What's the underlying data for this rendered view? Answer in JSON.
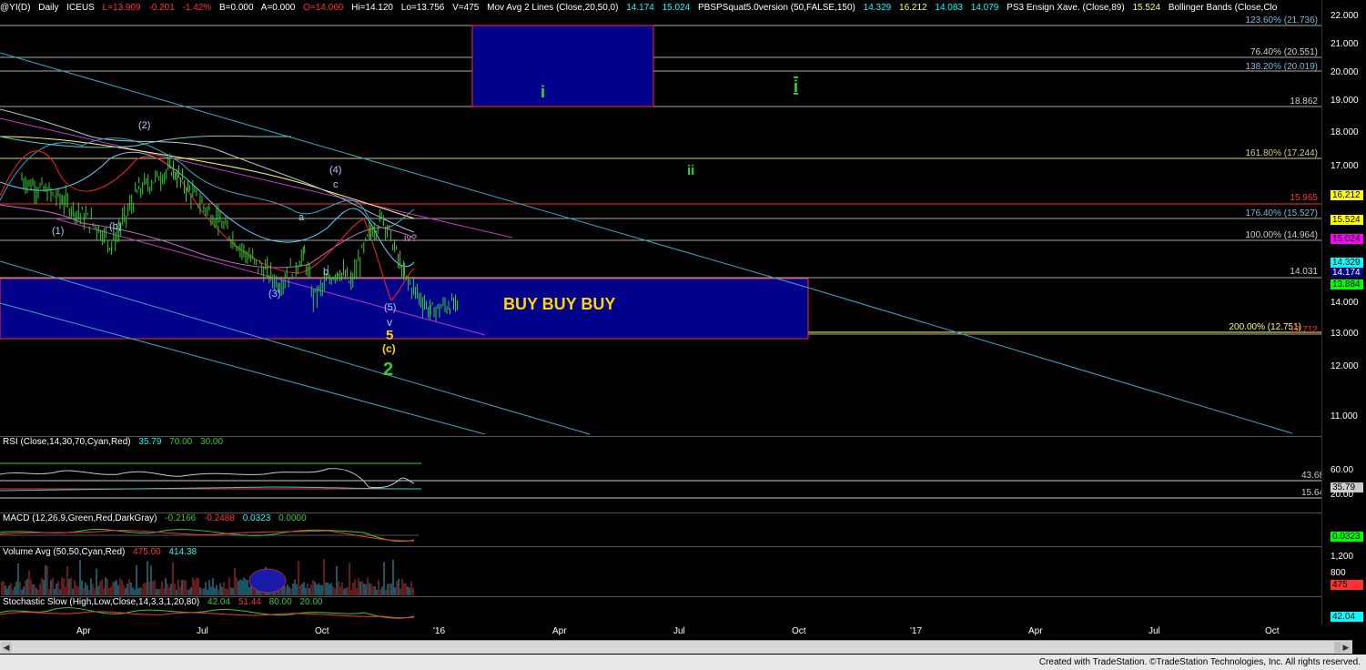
{
  "header": {
    "symbol": "@YI(D)",
    "interval": "Daily",
    "exchange": "ICEUS",
    "last": "L=13.909",
    "change": "-0.201",
    "change_pct": "-1.42%",
    "bid": "B=0.000",
    "ask": "A=0.000",
    "open": "O=14.060",
    "high": "Hi=14.120",
    "low": "Lo=13.756",
    "volume": "V=475",
    "study1_name": "Mov Avg 2 Lines (Close,20,50,0)",
    "study1_v1": "14.174",
    "study1_v2": "15.024",
    "study2_name": "PBSPSquat5.0version (50,FALSE,150)",
    "study2_v1": "14.329",
    "study2_v2": "16.212",
    "study2_v3": "14.083",
    "study2_v4": "14.079",
    "study3_name": "PS3 Ensign Xave. (Close,89)",
    "study3_v1": "15.524",
    "study4_name": "Bollinger Bands (Close,Clo"
  },
  "price_axis": {
    "ticks": [
      "22.000",
      "21.000",
      "20.000",
      "19.000",
      "18.000",
      "17.000",
      "16.000",
      "15.000",
      "14.000",
      "13.000",
      "12.000",
      "11.000"
    ],
    "tags": [
      {
        "text": "16.212",
        "bg": "#ffff00",
        "fg": "#000000"
      },
      {
        "text": "15.524",
        "bg": "#ffff00",
        "fg": "#000000"
      },
      {
        "text": "15.024",
        "bg": "#ff00ff",
        "fg": "#000000"
      },
      {
        "text": "14.329",
        "bg": "#00ffff",
        "fg": "#000000"
      },
      {
        "text": "14.174",
        "bg": "#000080",
        "fg": "#ffffff"
      },
      {
        "text": "13.884",
        "bg": "#00ff00",
        "fg": "#000000"
      }
    ]
  },
  "fib_levels": [
    {
      "text": "123.60% (21.736)",
      "color": "#7fb8d8"
    },
    {
      "text": "76.40% (20.551)",
      "color": "#cfcfcf"
    },
    {
      "text": "138.20% (20.019)",
      "color": "#7fb8d8"
    },
    {
      "text": "18.862",
      "color": "#cfcfcf"
    },
    {
      "text": "161.80% (17.244)",
      "color": "#cfcf7a"
    },
    {
      "text": "15.965",
      "color": "#ff3030"
    },
    {
      "text": "176.40% (15.527)",
      "color": "#7fb8d8"
    },
    {
      "text": "100.00% (14.964)",
      "color": "#cfcfcf"
    },
    {
      "text": "14.031",
      "color": "#cfcfcf"
    },
    {
      "text": "200.00% (12.751)",
      "color": "#ffff66"
    },
    {
      "text": "12.712",
      "color": "#ff3030"
    }
  ],
  "wave_labels": {
    "w1": "(1)",
    "w2": "(2)",
    "w3": "(3)",
    "w4": "(4)",
    "w5": "(5)",
    "wb1": "(b)",
    "wb2": "b",
    "wa": "a",
    "wc": "c",
    "wiv": "iv?",
    "big_v": "v",
    "big_5": "5",
    "big_c": "(c)",
    "big_2": "2",
    "target_i": "i",
    "target_ii": "ii",
    "target_box_i": "i"
  },
  "annotation": "BUY BUY BUY",
  "rsi": {
    "label": "RSI (Close,14,30,70,Cyan,Red)",
    "v1": "35.79",
    "v2": "70.00",
    "v3": "30.00",
    "ticks": [
      "60.00",
      "20.00"
    ],
    "line_high": "43.68",
    "line_low": "15.64",
    "tag": "35.79"
  },
  "macd": {
    "label": "MACD (12,26,9,Green,Red,DarkGray)",
    "v1": "-0.2166",
    "v2": "-0.2488",
    "v3": "0.0323",
    "v4": "0.0000",
    "tag": "0.0323"
  },
  "volume": {
    "label": "Volume Avg (50,50,Cyan,Red)",
    "v1": "475.00",
    "v2": "414.38",
    "ticks": [
      "1,200",
      "800",
      "400"
    ],
    "tag": "475"
  },
  "stoch": {
    "label": "Stochastic Slow (High,Low,Close,14,3,3,1,20,80)",
    "v1": "42.04",
    "v2": "51.44",
    "v3": "80.00",
    "v4": "20.00",
    "tag": "42.04"
  },
  "x_axis": {
    "ticks": [
      "Apr",
      "Jul",
      "Oct",
      "'16",
      "Apr",
      "Jul",
      "Oct",
      "'17",
      "Apr",
      "Jul",
      "Oct"
    ]
  },
  "footer": "Created with TradeStation. ©TradeStation Technologies, Inc. All rights reserved.",
  "colors": {
    "background": "#000000",
    "price_bars": "#33cc33",
    "channel_magenta": "#cc33cc",
    "channel_cyan": "#33aacc",
    "box_fill": "#00008b",
    "box_border": "#ff2a2a",
    "buy_text": "#ffd700",
    "wave_green": "#33cc33",
    "wave_yellow": "#ffd700"
  },
  "chart_data": {
    "type": "bar",
    "title": "@YI(D) Daily ICEUS",
    "xlabel": "",
    "ylabel": "",
    "ylim": [
      10.4,
      22.3
    ],
    "x_range": [
      "2015-01",
      "2017-11"
    ],
    "price_path_approx": [
      {
        "date": "2015-01-15",
        "close": 17.6
      },
      {
        "date": "2015-02-15",
        "close": 17.0
      },
      {
        "date": "2015-03-15",
        "close": 16.2
      },
      {
        "date": "2015-03-25",
        "close": 15.7
      },
      {
        "date": "2015-04-15",
        "close": 17.3
      },
      {
        "date": "2015-05-10",
        "close": 17.9
      },
      {
        "date": "2015-05-25",
        "close": 17.2
      },
      {
        "date": "2015-06-15",
        "close": 16.4
      },
      {
        "date": "2015-07-10",
        "close": 15.3
      },
      {
        "date": "2015-08-01",
        "close": 14.6
      },
      {
        "date": "2015-08-20",
        "close": 15.4
      },
      {
        "date": "2015-08-27",
        "close": 14.2
      },
      {
        "date": "2015-09-15",
        "close": 15.0
      },
      {
        "date": "2015-09-25",
        "close": 14.6
      },
      {
        "date": "2015-10-10",
        "close": 16.1
      },
      {
        "date": "2015-10-20",
        "close": 16.5
      },
      {
        "date": "2015-11-05",
        "close": 14.8
      },
      {
        "date": "2015-11-25",
        "close": 13.8
      },
      {
        "date": "2015-12-10",
        "close": 14.0
      },
      {
        "date": "2015-12-16",
        "close": 13.9
      }
    ],
    "horizontal_levels": [
      21.736,
      20.551,
      20.019,
      18.862,
      17.244,
      15.965,
      15.527,
      14.964,
      14.031,
      12.751,
      12.712
    ],
    "zones": [
      {
        "label": "i",
        "from": 18.862,
        "to": 21.736,
        "x_start": "2016-02",
        "x_end": "2016-05"
      },
      {
        "label": "BUY BUY BUY",
        "from": 12.6,
        "to": 14.031,
        "x_start": "2015-01",
        "x_end": "2016-08"
      }
    ]
  }
}
